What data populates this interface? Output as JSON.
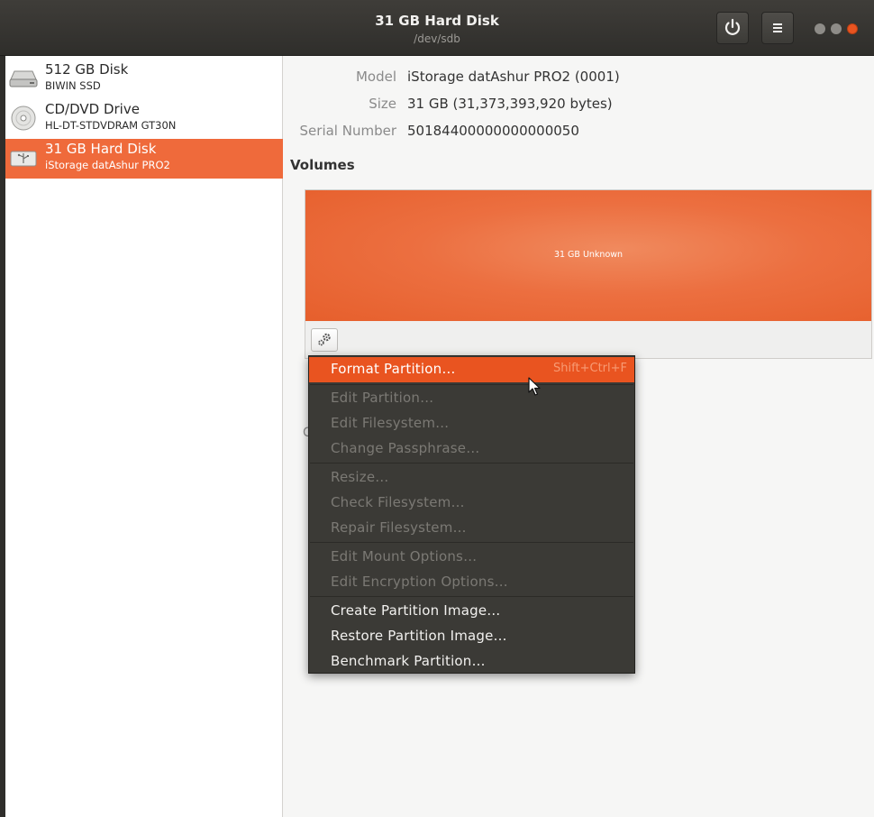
{
  "window": {
    "title": "31 GB Hard Disk",
    "subtitle": "/dev/sdb"
  },
  "header_buttons": {
    "power_icon": "power-icon",
    "menu_icon": "hamburger-menu-icon"
  },
  "colors": {
    "accent": "#e95420",
    "selection": "#ef6a3b",
    "volume": "#ec6f40",
    "menu_bg": "#3b3a36"
  },
  "sidebar": {
    "items": [
      {
        "name": "512 GB Disk",
        "sub": "BIWIN SSD",
        "icon": "hard-disk-icon"
      },
      {
        "name": "CD/DVD Drive",
        "sub": "HL-DT-STDVDRAM GT30N",
        "icon": "optical-disc-icon"
      },
      {
        "name": "31 GB Hard Disk",
        "sub": "iStorage datAshur PRO2",
        "icon": "usb-drive-icon",
        "selected": true
      }
    ]
  },
  "details": {
    "model_label": "Model",
    "model_value": "iStorage datAshur PRO2 (0001)",
    "size_label": "Size",
    "size_value": "31 GB (31,373,393,920 bytes)",
    "serial_label": "Serial Number",
    "serial_value": "50184400000000000050"
  },
  "volumes": {
    "heading": "Volumes",
    "volume_label": "31 GB Unknown"
  },
  "stray": "C",
  "menu": {
    "items": [
      {
        "label": "Format Partition…",
        "accel": "Shift+Ctrl+F",
        "enabled": true,
        "highlighted": true
      },
      {
        "label": "Edit Partition…",
        "enabled": false
      },
      {
        "label": "Edit Filesystem…",
        "enabled": false
      },
      {
        "label": "Change Passphrase…",
        "enabled": false
      },
      {
        "label": "Resize…",
        "enabled": false
      },
      {
        "label": "Check Filesystem…",
        "enabled": false
      },
      {
        "label": "Repair Filesystem…",
        "enabled": false
      },
      {
        "label": "Edit Mount Options…",
        "enabled": false
      },
      {
        "label": "Edit Encryption Options…",
        "enabled": false
      },
      {
        "label": "Create Partition Image…",
        "enabled": true
      },
      {
        "label": "Restore Partition Image…",
        "enabled": true
      },
      {
        "label": "Benchmark Partition…",
        "enabled": true
      }
    ]
  }
}
